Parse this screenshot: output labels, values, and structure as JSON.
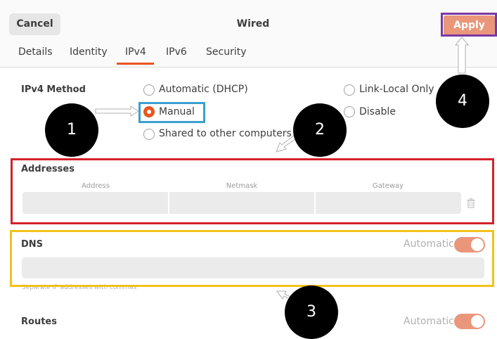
{
  "header": {
    "cancel": "Cancel",
    "title": "Wired",
    "apply": "Apply"
  },
  "tabs": [
    {
      "label": "Details"
    },
    {
      "label": "Identity"
    },
    {
      "label": "IPv4",
      "selected": true
    },
    {
      "label": "IPv6"
    },
    {
      "label": "Security"
    }
  ],
  "ipv4": {
    "method_label": "IPv4 Method",
    "options": [
      {
        "label": "Automatic (DHCP)",
        "selected": false
      },
      {
        "label": "Manual",
        "selected": true
      },
      {
        "label": "Shared to other computers",
        "selected": false
      },
      {
        "label": "Link-Local Only",
        "selected": false
      },
      {
        "label": "Disable",
        "selected": false
      }
    ]
  },
  "addresses": {
    "title": "Addresses",
    "columns": [
      "Address",
      "Netmask",
      "Gateway"
    ]
  },
  "dns": {
    "title": "DNS",
    "automatic_label": "Automatic",
    "automatic_on": true,
    "hint": "Separate IP addresses with commas"
  },
  "routes": {
    "title": "Routes",
    "automatic_label": "Automatic",
    "automatic_on": true
  },
  "callouts": [
    "1",
    "2",
    "3",
    "4"
  ],
  "colors": {
    "accent": "#e95420",
    "apply": "#e9967a",
    "box_manual": "#3aa0d0",
    "box_addresses": "#d2232a",
    "box_dns": "#f2c21a",
    "box_apply": "#7a38a6"
  }
}
